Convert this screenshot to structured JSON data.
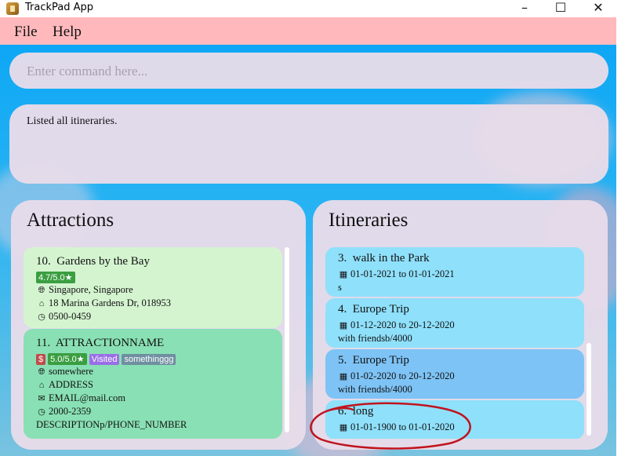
{
  "window": {
    "title": "TrackPad App",
    "minimize": "–",
    "maximize": "☐",
    "close": "✕"
  },
  "menu": {
    "file": "File",
    "help": "Help"
  },
  "command": {
    "placeholder": "Enter command here...",
    "value": ""
  },
  "result": {
    "text": "Listed all itineraries."
  },
  "attractions": {
    "title": "Attractions",
    "items": [
      {
        "index": "10.",
        "name": "Gardens by the Bay",
        "rating": "4.7/5.0★",
        "location": "Singapore, Singapore",
        "address": "18 Marina Gardens Dr, 018953",
        "hours": "0500-0459"
      },
      {
        "index": "11.",
        "name": "ATTRACTIONNAME",
        "price": "$",
        "rating": "5.0/5.0★",
        "visited": "Visited",
        "tag": "somethinggg",
        "location": "somewhere",
        "address": "ADDRESS",
        "email": "EMAIL@mail.com",
        "hours": "2000-2359",
        "description": "DESCRIPTIONp/PHONE_NUMBER"
      }
    ]
  },
  "itineraries": {
    "title": "Itineraries",
    "items": [
      {
        "index": "3.",
        "name": "walk in the Park",
        "dates": "01-01-2021 to 01-01-2021",
        "note": "s"
      },
      {
        "index": "4.",
        "name": "Europe Trip",
        "dates": "01-12-2020 to 20-12-2020",
        "note": "with friendsb/4000"
      },
      {
        "index": "5.",
        "name": "Europe Trip",
        "dates": "01-02-2020 to 20-12-2020",
        "note": "with friendsb/4000"
      },
      {
        "index": "6.",
        "name": "long",
        "dates": "01-01-1900 to 01-01-2020"
      }
    ]
  },
  "icons": {
    "globe": "🌐︎",
    "home": "⌂",
    "clock": "◷",
    "mail": "✉",
    "calendar": "▦"
  },
  "colors": {
    "menu_bg": "#ffb9bd",
    "panel_bg": "#e8dce9",
    "card_green_light": "#d4f4d0",
    "card_green_selected": "#89e0b4",
    "card_blue": "#8fe0fb",
    "card_blue_selected": "#7ec3f5",
    "rating_green": "#3b9e41",
    "price_red": "#c24a4a",
    "visited_purple": "#9a6ee6",
    "tag_gray": "#6f8fa0",
    "annotation_red": "#c0141e"
  }
}
